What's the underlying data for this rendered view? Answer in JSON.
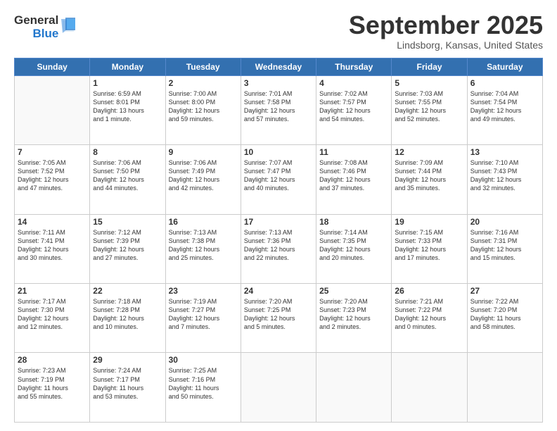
{
  "header": {
    "logo_general": "General",
    "logo_blue": "Blue",
    "month": "September 2025",
    "location": "Lindsborg, Kansas, United States"
  },
  "weekdays": [
    "Sunday",
    "Monday",
    "Tuesday",
    "Wednesday",
    "Thursday",
    "Friday",
    "Saturday"
  ],
  "weeks": [
    [
      {
        "day": "",
        "info": ""
      },
      {
        "day": "1",
        "info": "Sunrise: 6:59 AM\nSunset: 8:01 PM\nDaylight: 13 hours\nand 1 minute."
      },
      {
        "day": "2",
        "info": "Sunrise: 7:00 AM\nSunset: 8:00 PM\nDaylight: 12 hours\nand 59 minutes."
      },
      {
        "day": "3",
        "info": "Sunrise: 7:01 AM\nSunset: 7:58 PM\nDaylight: 12 hours\nand 57 minutes."
      },
      {
        "day": "4",
        "info": "Sunrise: 7:02 AM\nSunset: 7:57 PM\nDaylight: 12 hours\nand 54 minutes."
      },
      {
        "day": "5",
        "info": "Sunrise: 7:03 AM\nSunset: 7:55 PM\nDaylight: 12 hours\nand 52 minutes."
      },
      {
        "day": "6",
        "info": "Sunrise: 7:04 AM\nSunset: 7:54 PM\nDaylight: 12 hours\nand 49 minutes."
      }
    ],
    [
      {
        "day": "7",
        "info": "Sunrise: 7:05 AM\nSunset: 7:52 PM\nDaylight: 12 hours\nand 47 minutes."
      },
      {
        "day": "8",
        "info": "Sunrise: 7:06 AM\nSunset: 7:50 PM\nDaylight: 12 hours\nand 44 minutes."
      },
      {
        "day": "9",
        "info": "Sunrise: 7:06 AM\nSunset: 7:49 PM\nDaylight: 12 hours\nand 42 minutes."
      },
      {
        "day": "10",
        "info": "Sunrise: 7:07 AM\nSunset: 7:47 PM\nDaylight: 12 hours\nand 40 minutes."
      },
      {
        "day": "11",
        "info": "Sunrise: 7:08 AM\nSunset: 7:46 PM\nDaylight: 12 hours\nand 37 minutes."
      },
      {
        "day": "12",
        "info": "Sunrise: 7:09 AM\nSunset: 7:44 PM\nDaylight: 12 hours\nand 35 minutes."
      },
      {
        "day": "13",
        "info": "Sunrise: 7:10 AM\nSunset: 7:43 PM\nDaylight: 12 hours\nand 32 minutes."
      }
    ],
    [
      {
        "day": "14",
        "info": "Sunrise: 7:11 AM\nSunset: 7:41 PM\nDaylight: 12 hours\nand 30 minutes."
      },
      {
        "day": "15",
        "info": "Sunrise: 7:12 AM\nSunset: 7:39 PM\nDaylight: 12 hours\nand 27 minutes."
      },
      {
        "day": "16",
        "info": "Sunrise: 7:13 AM\nSunset: 7:38 PM\nDaylight: 12 hours\nand 25 minutes."
      },
      {
        "day": "17",
        "info": "Sunrise: 7:13 AM\nSunset: 7:36 PM\nDaylight: 12 hours\nand 22 minutes."
      },
      {
        "day": "18",
        "info": "Sunrise: 7:14 AM\nSunset: 7:35 PM\nDaylight: 12 hours\nand 20 minutes."
      },
      {
        "day": "19",
        "info": "Sunrise: 7:15 AM\nSunset: 7:33 PM\nDaylight: 12 hours\nand 17 minutes."
      },
      {
        "day": "20",
        "info": "Sunrise: 7:16 AM\nSunset: 7:31 PM\nDaylight: 12 hours\nand 15 minutes."
      }
    ],
    [
      {
        "day": "21",
        "info": "Sunrise: 7:17 AM\nSunset: 7:30 PM\nDaylight: 12 hours\nand 12 minutes."
      },
      {
        "day": "22",
        "info": "Sunrise: 7:18 AM\nSunset: 7:28 PM\nDaylight: 12 hours\nand 10 minutes."
      },
      {
        "day": "23",
        "info": "Sunrise: 7:19 AM\nSunset: 7:27 PM\nDaylight: 12 hours\nand 7 minutes."
      },
      {
        "day": "24",
        "info": "Sunrise: 7:20 AM\nSunset: 7:25 PM\nDaylight: 12 hours\nand 5 minutes."
      },
      {
        "day": "25",
        "info": "Sunrise: 7:20 AM\nSunset: 7:23 PM\nDaylight: 12 hours\nand 2 minutes."
      },
      {
        "day": "26",
        "info": "Sunrise: 7:21 AM\nSunset: 7:22 PM\nDaylight: 12 hours\nand 0 minutes."
      },
      {
        "day": "27",
        "info": "Sunrise: 7:22 AM\nSunset: 7:20 PM\nDaylight: 11 hours\nand 58 minutes."
      }
    ],
    [
      {
        "day": "28",
        "info": "Sunrise: 7:23 AM\nSunset: 7:19 PM\nDaylight: 11 hours\nand 55 minutes."
      },
      {
        "day": "29",
        "info": "Sunrise: 7:24 AM\nSunset: 7:17 PM\nDaylight: 11 hours\nand 53 minutes."
      },
      {
        "day": "30",
        "info": "Sunrise: 7:25 AM\nSunset: 7:16 PM\nDaylight: 11 hours\nand 50 minutes."
      },
      {
        "day": "",
        "info": ""
      },
      {
        "day": "",
        "info": ""
      },
      {
        "day": "",
        "info": ""
      },
      {
        "day": "",
        "info": ""
      }
    ]
  ]
}
